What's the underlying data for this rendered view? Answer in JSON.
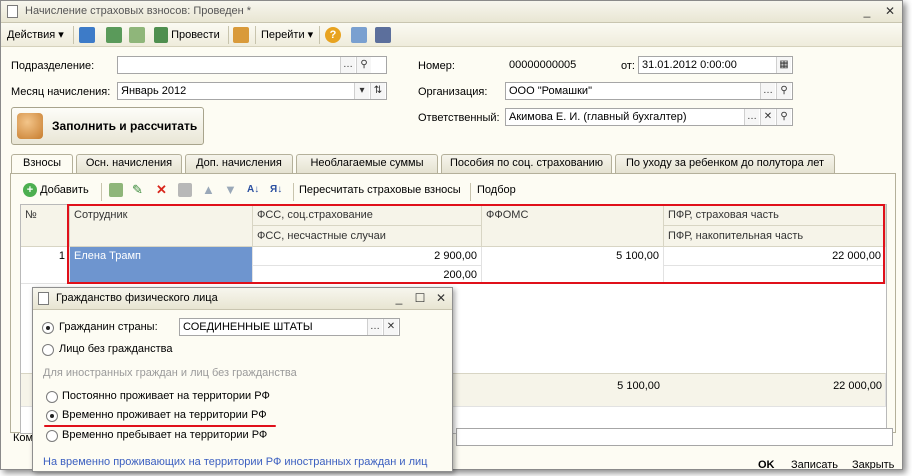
{
  "window": {
    "title": "Начисление страховых взносов: Проведен *"
  },
  "toolbar": {
    "actions_label": "Действия",
    "post_label": "Провести",
    "goto_label": "Перейти"
  },
  "form": {
    "department_label": "Подразделение:",
    "department_value": "",
    "month_label": "Месяц начисления:",
    "month_value": "Январь 2012",
    "number_label": "Номер:",
    "number_value": "00000000005",
    "date_label": "от:",
    "date_value": "31.01.2012  0:00:00",
    "org_label": "Организация:",
    "org_value": "ООО \"Ромашки\"",
    "resp_label": "Ответственный:",
    "resp_value": "Акимова Е. И. (главный бухгалтер)",
    "fill_button": "Заполнить и рассчитать",
    "comment_label": "Ком"
  },
  "tabs": [
    "Взносы",
    "Осн. начисления",
    "Доп. начисления",
    "Необлагаемые суммы",
    "Пособия по соц. страхованию",
    "По уходу за ребенком до полутора лет"
  ],
  "grid_toolbar": {
    "add_label": "Добавить",
    "recalc_label": "Пересчитать страховые взносы",
    "select_label": "Подбор"
  },
  "grid": {
    "headers": {
      "num": "№",
      "employee": "Сотрудник",
      "fss_social": "ФСС, соц.страхование",
      "fss_accident": "ФСС, несчастные случаи",
      "ffoms": "ФФОМС",
      "pfr_insurance": "ПФР, страховая часть",
      "pfr_funded": "ПФР, накопительная часть"
    },
    "rows": [
      {
        "num": "1",
        "employee": "Елена Трамп",
        "fss_social": "2 900,00",
        "fss_accident": "200,00",
        "ffoms": "5 100,00",
        "pfr_insurance": "22 000,00"
      }
    ],
    "totals": {
      "ffoms": "5 100,00",
      "pfr_insurance": "22 000,00"
    }
  },
  "dialog": {
    "title": "Гражданство физического лица",
    "citizen_label": "Гражданин страны:",
    "citizen_value": "СОЕДИНЕННЫЕ ШТАТЫ",
    "stateless_label": "Лицо без гражданства",
    "group_header": "Для иностранных граждан и лиц без гражданства",
    "opt_permanent": "Постоянно проживает на территории РФ",
    "opt_temp_resident": "Временно проживает на территории РФ",
    "opt_temp_stay": "Временно пребывает на территории РФ",
    "hint": "На временно проживающих на территории РФ иностранных граждан и лиц"
  },
  "footer": {
    "ok_label": "OK",
    "write_label": "Записать",
    "close_label": "Закрыть"
  },
  "colors": {
    "highlight_box": "#e0101a",
    "selected_cell": "#6e95cf",
    "window_bg": "#fdfcf3"
  }
}
